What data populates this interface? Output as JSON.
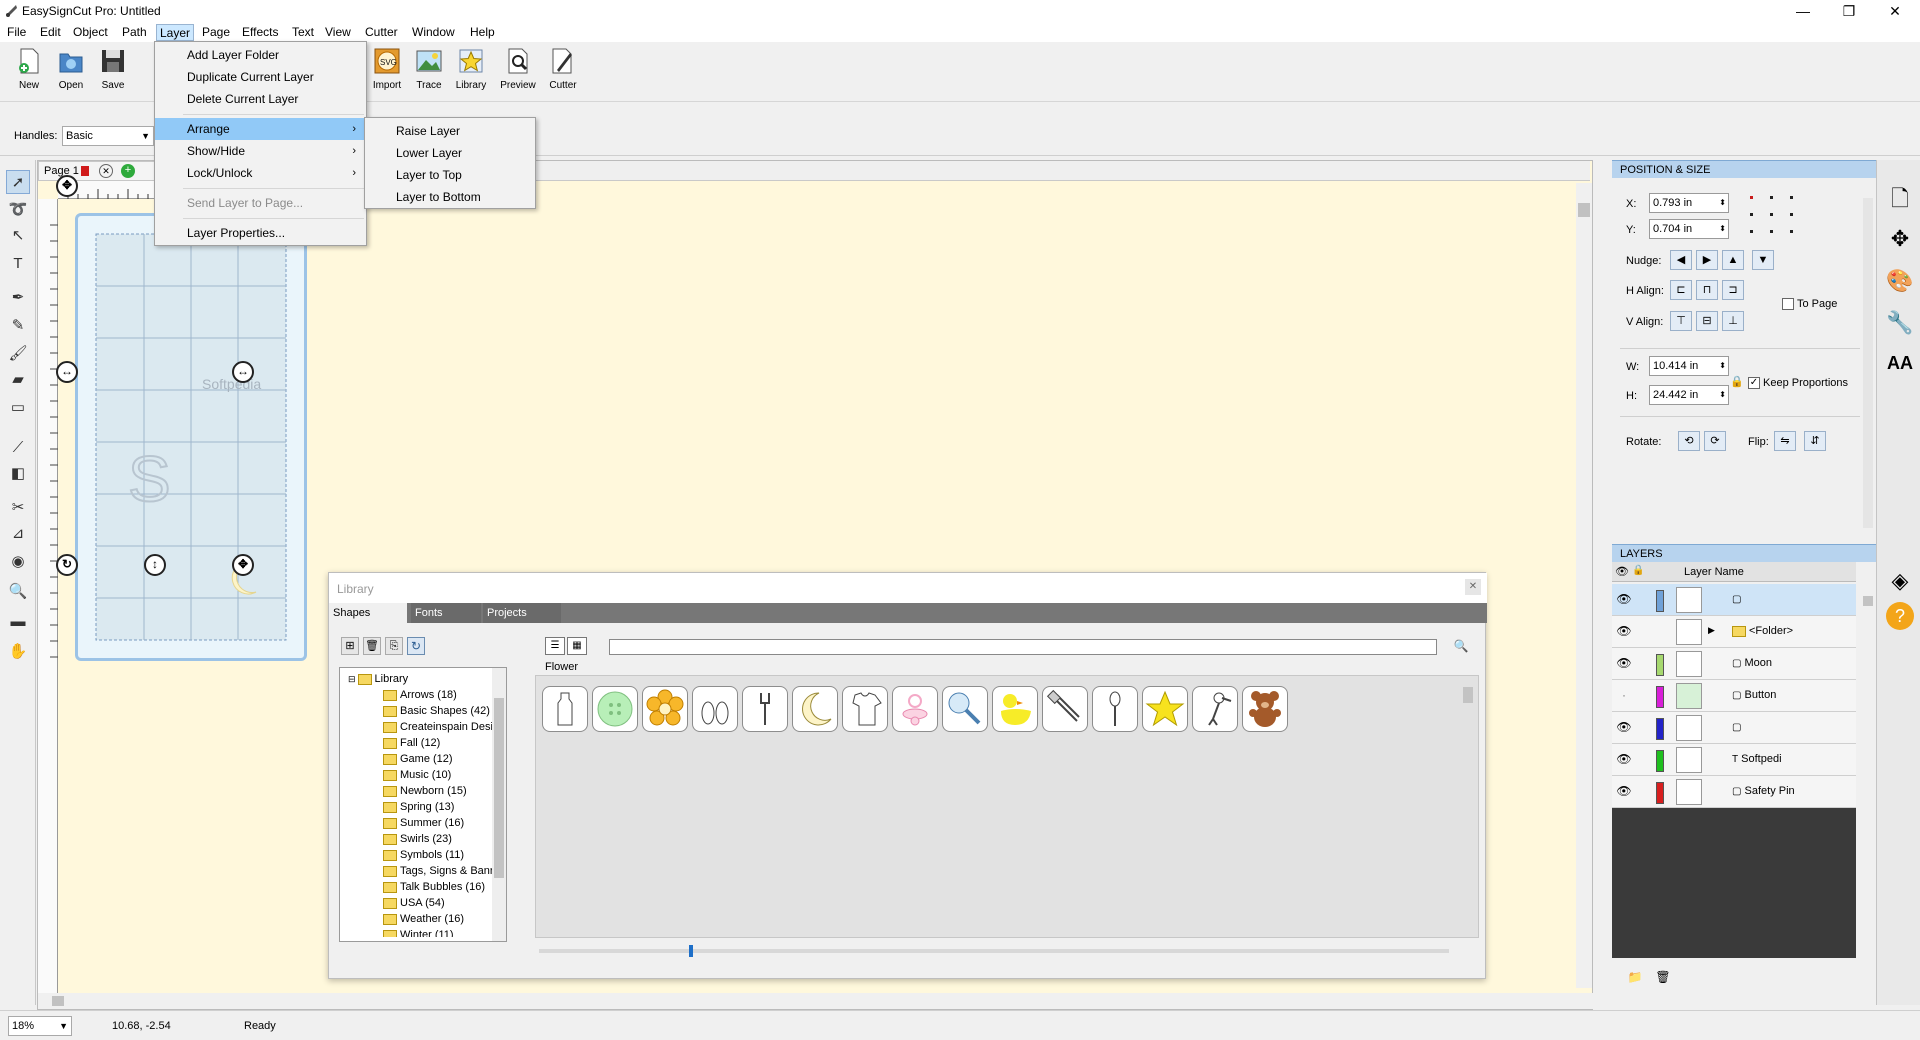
{
  "window": {
    "title": "EasySignCut Pro: Untitled",
    "minimize": "—",
    "maximize": "❐",
    "close": "✕"
  },
  "menubar": [
    "File",
    "Edit",
    "Object",
    "Path",
    "Layer",
    "Page",
    "Effects",
    "Text",
    "View",
    "Cutter",
    "Window",
    "Help"
  ],
  "toolbar": {
    "new": "New",
    "open": "Open",
    "save": "Save",
    "import": "Import",
    "trace": "Trace",
    "library": "Library",
    "preview": "Preview",
    "cutter": "Cutter"
  },
  "options": {
    "handles_label": "Handles:",
    "handles_value": "Basic"
  },
  "layer_menu": {
    "add_folder": "Add Layer Folder",
    "duplicate": "Duplicate Current Layer",
    "delete": "Delete Current Layer",
    "arrange": "Arrange",
    "show_hide": "Show/Hide",
    "lock_unlock": "Lock/Unlock",
    "send_to_page": "Send Layer to Page...",
    "properties": "Layer Properties..."
  },
  "arrange_menu": {
    "raise": "Raise Layer",
    "lower": "Lower Layer",
    "top": "Layer to Top",
    "bottom": "Layer to Bottom"
  },
  "canvas": {
    "page_tab": "Page 1",
    "watermark": "Softpedia",
    "big_letter": "S"
  },
  "library": {
    "title": "Library",
    "tabs": [
      "Shapes",
      "Fonts",
      "Projects"
    ],
    "root": "Library",
    "folders": [
      "Arrows (18)",
      "Basic Shapes (42)",
      "Createinspain Desi",
      "Fall (12)",
      "Game (12)",
      "Music (10)",
      "Newborn (15)",
      "Spring (13)",
      "Summer (16)",
      "Swirls (23)",
      "Symbols (11)",
      "Tags, Signs & Banr",
      "Talk Bubbles (16)",
      "USA (54)",
      "Weather (16)",
      "Winter (11)"
    ],
    "category": "Flower",
    "shape_icons": [
      "bottle",
      "button",
      "flower",
      "feet",
      "fork",
      "moon",
      "onesie",
      "pacifier",
      "rattle",
      "duck",
      "safety-pin",
      "spoon",
      "star",
      "stork",
      "bear"
    ]
  },
  "position_size": {
    "title": "POSITION & SIZE",
    "x_label": "X:",
    "x_value": "0.793 in",
    "y_label": "Y:",
    "y_value": "0.704 in",
    "nudge_label": "Nudge:",
    "halign_label": "H Align:",
    "valign_label": "V Align:",
    "to_page": "To Page",
    "w_label": "W:",
    "w_value": "10.414 in",
    "h_label": "H:",
    "h_value": "24.442 in",
    "keep_proportions": "Keep Proportions",
    "rotate_label": "Rotate:",
    "flip_label": "Flip:"
  },
  "layers": {
    "title": "LAYERS",
    "col_name": "Layer Name",
    "rows": [
      {
        "name": "",
        "color": "#6fa1d8"
      },
      {
        "name": "<Folder>",
        "color": "#ffffff"
      },
      {
        "name": "Moon",
        "color": "#a6d86f"
      },
      {
        "name": "Button",
        "color": "#d81fd8"
      },
      {
        "name": "",
        "color": "#2323c8"
      },
      {
        "name": "Softpedi",
        "color": "#1fbf1f"
      },
      {
        "name": "Safety Pin",
        "color": "#d81f1f"
      }
    ]
  },
  "status": {
    "zoom": "18%",
    "coords": "10.68, -2.54",
    "state": "Ready"
  }
}
